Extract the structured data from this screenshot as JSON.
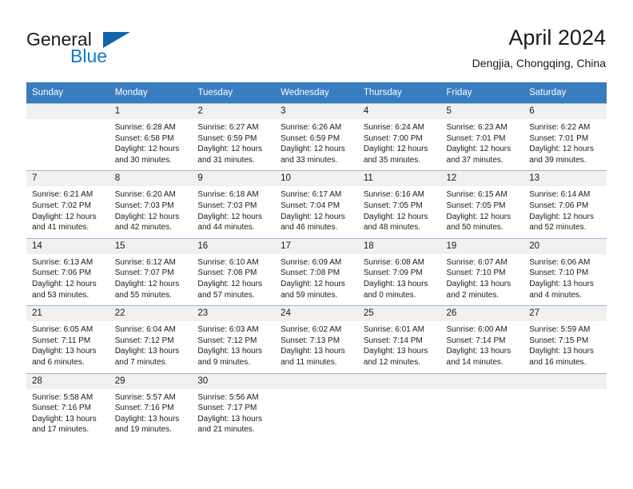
{
  "brand": {
    "name_part1": "General",
    "name_part2": "Blue",
    "logo_icon": "blue-triangle-icon",
    "accent_color": "#1279c6",
    "triangle_color": "#1065ab"
  },
  "header": {
    "month_title": "April 2024",
    "location": "Dengjia, Chongqing, China"
  },
  "colors": {
    "header_blue": "#3a7cc0",
    "daynum_band": "#f0f0f0",
    "row_border": "#9bb9d6"
  },
  "weekday_headers": [
    "Sunday",
    "Monday",
    "Tuesday",
    "Wednesday",
    "Thursday",
    "Friday",
    "Saturday"
  ],
  "labels": {
    "sunrise_prefix": "Sunrise:",
    "sunset_prefix": "Sunset:",
    "daylight_prefix": "Daylight:"
  },
  "weeks": [
    [
      {
        "day": "",
        "sunrise": "",
        "sunset": "",
        "daylight_line1": "",
        "daylight_line2": ""
      },
      {
        "day": "1",
        "sunrise": "Sunrise: 6:28 AM",
        "sunset": "Sunset: 6:58 PM",
        "daylight_line1": "Daylight: 12 hours",
        "daylight_line2": "and 30 minutes."
      },
      {
        "day": "2",
        "sunrise": "Sunrise: 6:27 AM",
        "sunset": "Sunset: 6:59 PM",
        "daylight_line1": "Daylight: 12 hours",
        "daylight_line2": "and 31 minutes."
      },
      {
        "day": "3",
        "sunrise": "Sunrise: 6:26 AM",
        "sunset": "Sunset: 6:59 PM",
        "daylight_line1": "Daylight: 12 hours",
        "daylight_line2": "and 33 minutes."
      },
      {
        "day": "4",
        "sunrise": "Sunrise: 6:24 AM",
        "sunset": "Sunset: 7:00 PM",
        "daylight_line1": "Daylight: 12 hours",
        "daylight_line2": "and 35 minutes."
      },
      {
        "day": "5",
        "sunrise": "Sunrise: 6:23 AM",
        "sunset": "Sunset: 7:01 PM",
        "daylight_line1": "Daylight: 12 hours",
        "daylight_line2": "and 37 minutes."
      },
      {
        "day": "6",
        "sunrise": "Sunrise: 6:22 AM",
        "sunset": "Sunset: 7:01 PM",
        "daylight_line1": "Daylight: 12 hours",
        "daylight_line2": "and 39 minutes."
      }
    ],
    [
      {
        "day": "7",
        "sunrise": "Sunrise: 6:21 AM",
        "sunset": "Sunset: 7:02 PM",
        "daylight_line1": "Daylight: 12 hours",
        "daylight_line2": "and 41 minutes."
      },
      {
        "day": "8",
        "sunrise": "Sunrise: 6:20 AM",
        "sunset": "Sunset: 7:03 PM",
        "daylight_line1": "Daylight: 12 hours",
        "daylight_line2": "and 42 minutes."
      },
      {
        "day": "9",
        "sunrise": "Sunrise: 6:18 AM",
        "sunset": "Sunset: 7:03 PM",
        "daylight_line1": "Daylight: 12 hours",
        "daylight_line2": "and 44 minutes."
      },
      {
        "day": "10",
        "sunrise": "Sunrise: 6:17 AM",
        "sunset": "Sunset: 7:04 PM",
        "daylight_line1": "Daylight: 12 hours",
        "daylight_line2": "and 46 minutes."
      },
      {
        "day": "11",
        "sunrise": "Sunrise: 6:16 AM",
        "sunset": "Sunset: 7:05 PM",
        "daylight_line1": "Daylight: 12 hours",
        "daylight_line2": "and 48 minutes."
      },
      {
        "day": "12",
        "sunrise": "Sunrise: 6:15 AM",
        "sunset": "Sunset: 7:05 PM",
        "daylight_line1": "Daylight: 12 hours",
        "daylight_line2": "and 50 minutes."
      },
      {
        "day": "13",
        "sunrise": "Sunrise: 6:14 AM",
        "sunset": "Sunset: 7:06 PM",
        "daylight_line1": "Daylight: 12 hours",
        "daylight_line2": "and 52 minutes."
      }
    ],
    [
      {
        "day": "14",
        "sunrise": "Sunrise: 6:13 AM",
        "sunset": "Sunset: 7:06 PM",
        "daylight_line1": "Daylight: 12 hours",
        "daylight_line2": "and 53 minutes."
      },
      {
        "day": "15",
        "sunrise": "Sunrise: 6:12 AM",
        "sunset": "Sunset: 7:07 PM",
        "daylight_line1": "Daylight: 12 hours",
        "daylight_line2": "and 55 minutes."
      },
      {
        "day": "16",
        "sunrise": "Sunrise: 6:10 AM",
        "sunset": "Sunset: 7:08 PM",
        "daylight_line1": "Daylight: 12 hours",
        "daylight_line2": "and 57 minutes."
      },
      {
        "day": "17",
        "sunrise": "Sunrise: 6:09 AM",
        "sunset": "Sunset: 7:08 PM",
        "daylight_line1": "Daylight: 12 hours",
        "daylight_line2": "and 59 minutes."
      },
      {
        "day": "18",
        "sunrise": "Sunrise: 6:08 AM",
        "sunset": "Sunset: 7:09 PM",
        "daylight_line1": "Daylight: 13 hours",
        "daylight_line2": "and 0 minutes."
      },
      {
        "day": "19",
        "sunrise": "Sunrise: 6:07 AM",
        "sunset": "Sunset: 7:10 PM",
        "daylight_line1": "Daylight: 13 hours",
        "daylight_line2": "and 2 minutes."
      },
      {
        "day": "20",
        "sunrise": "Sunrise: 6:06 AM",
        "sunset": "Sunset: 7:10 PM",
        "daylight_line1": "Daylight: 13 hours",
        "daylight_line2": "and 4 minutes."
      }
    ],
    [
      {
        "day": "21",
        "sunrise": "Sunrise: 6:05 AM",
        "sunset": "Sunset: 7:11 PM",
        "daylight_line1": "Daylight: 13 hours",
        "daylight_line2": "and 6 minutes."
      },
      {
        "day": "22",
        "sunrise": "Sunrise: 6:04 AM",
        "sunset": "Sunset: 7:12 PM",
        "daylight_line1": "Daylight: 13 hours",
        "daylight_line2": "and 7 minutes."
      },
      {
        "day": "23",
        "sunrise": "Sunrise: 6:03 AM",
        "sunset": "Sunset: 7:12 PM",
        "daylight_line1": "Daylight: 13 hours",
        "daylight_line2": "and 9 minutes."
      },
      {
        "day": "24",
        "sunrise": "Sunrise: 6:02 AM",
        "sunset": "Sunset: 7:13 PM",
        "daylight_line1": "Daylight: 13 hours",
        "daylight_line2": "and 11 minutes."
      },
      {
        "day": "25",
        "sunrise": "Sunrise: 6:01 AM",
        "sunset": "Sunset: 7:14 PM",
        "daylight_line1": "Daylight: 13 hours",
        "daylight_line2": "and 12 minutes."
      },
      {
        "day": "26",
        "sunrise": "Sunrise: 6:00 AM",
        "sunset": "Sunset: 7:14 PM",
        "daylight_line1": "Daylight: 13 hours",
        "daylight_line2": "and 14 minutes."
      },
      {
        "day": "27",
        "sunrise": "Sunrise: 5:59 AM",
        "sunset": "Sunset: 7:15 PM",
        "daylight_line1": "Daylight: 13 hours",
        "daylight_line2": "and 16 minutes."
      }
    ],
    [
      {
        "day": "28",
        "sunrise": "Sunrise: 5:58 AM",
        "sunset": "Sunset: 7:16 PM",
        "daylight_line1": "Daylight: 13 hours",
        "daylight_line2": "and 17 minutes."
      },
      {
        "day": "29",
        "sunrise": "Sunrise: 5:57 AM",
        "sunset": "Sunset: 7:16 PM",
        "daylight_line1": "Daylight: 13 hours",
        "daylight_line2": "and 19 minutes."
      },
      {
        "day": "30",
        "sunrise": "Sunrise: 5:56 AM",
        "sunset": "Sunset: 7:17 PM",
        "daylight_line1": "Daylight: 13 hours",
        "daylight_line2": "and 21 minutes."
      },
      {
        "day": "",
        "sunrise": "",
        "sunset": "",
        "daylight_line1": "",
        "daylight_line2": ""
      },
      {
        "day": "",
        "sunrise": "",
        "sunset": "",
        "daylight_line1": "",
        "daylight_line2": ""
      },
      {
        "day": "",
        "sunrise": "",
        "sunset": "",
        "daylight_line1": "",
        "daylight_line2": ""
      },
      {
        "day": "",
        "sunrise": "",
        "sunset": "",
        "daylight_line1": "",
        "daylight_line2": ""
      }
    ]
  ]
}
